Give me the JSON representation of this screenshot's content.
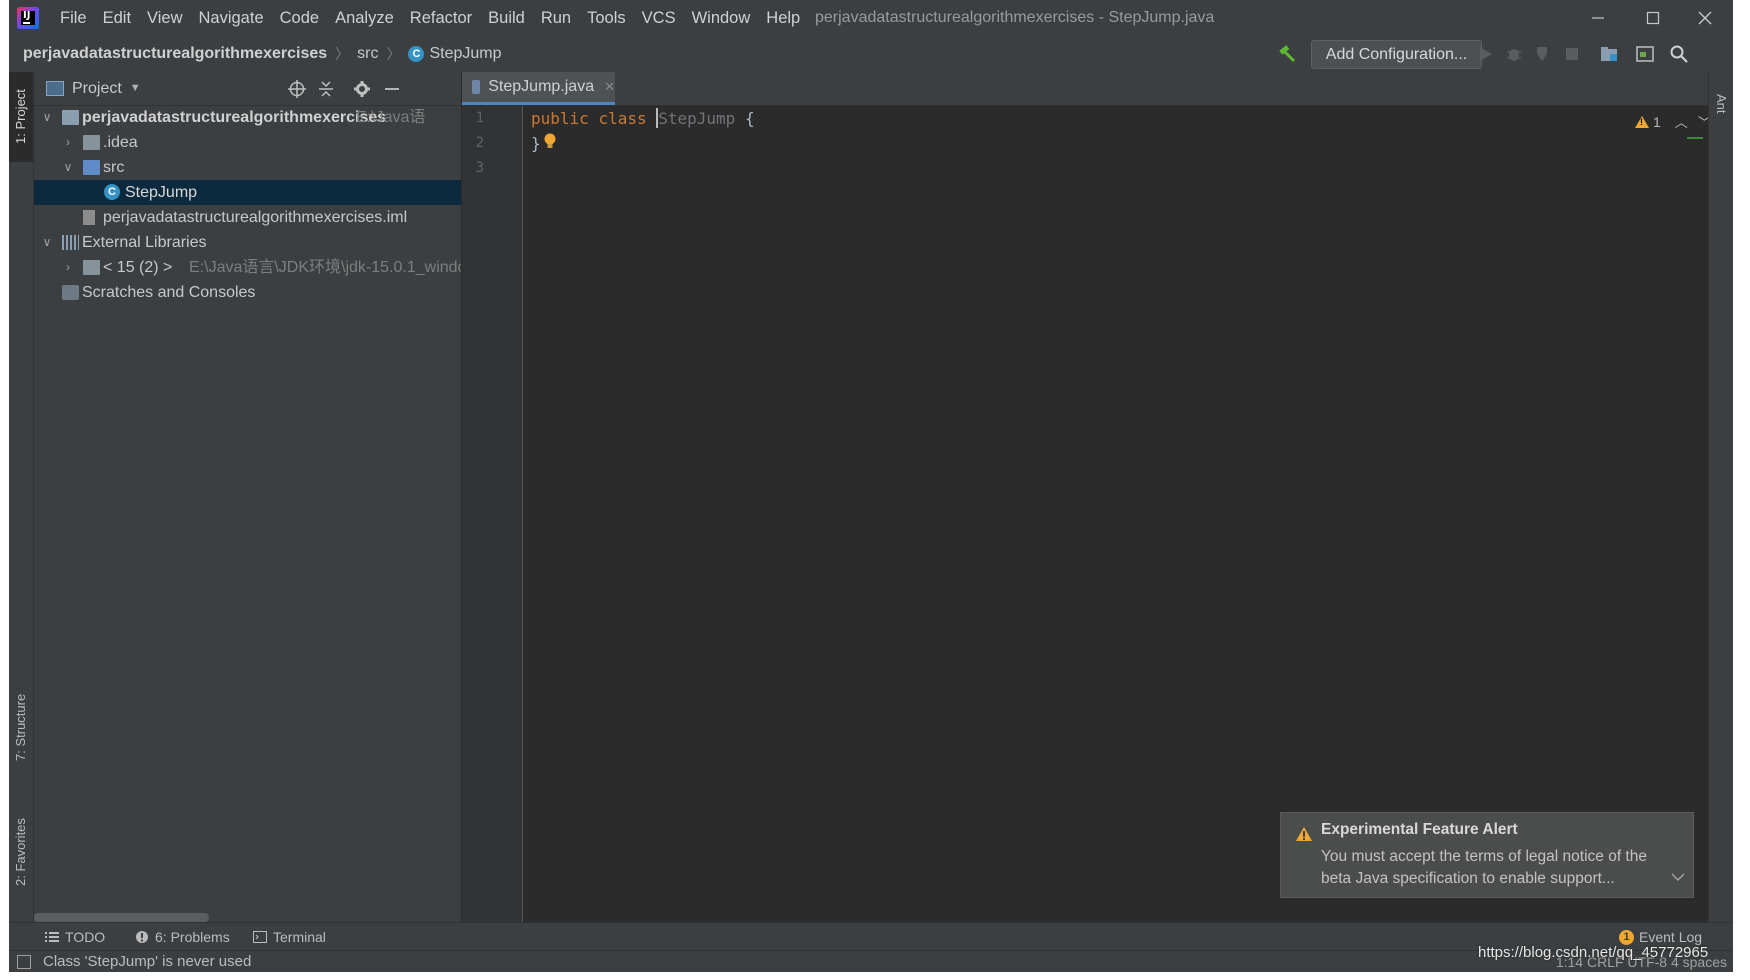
{
  "menu": {
    "items": [
      "File",
      "Edit",
      "View",
      "Navigate",
      "Code",
      "Analyze",
      "Refactor",
      "Build",
      "Run",
      "Tools",
      "VCS",
      "Window",
      "Help"
    ]
  },
  "window": {
    "title": "perjavadatastructurealgorithmexercises - StepJump.java"
  },
  "breadcrumb": {
    "project": "perjavadatastructurealgorithmexercises",
    "folder": "src",
    "file": "StepJump"
  },
  "toolbar": {
    "add_config_label": "Add Configuration..."
  },
  "left_stripe": {
    "project_tab": "1: Project",
    "structure_tab": "7: Structure",
    "favorites_tab": "2: Favorites"
  },
  "right_stripe": {
    "ant_tab": "Ant"
  },
  "project_panel": {
    "title": "Project",
    "tree": [
      {
        "label": "perjavadatastructurealgorithmexercises",
        "hint": "E:\\Java语",
        "expanded": true
      },
      {
        "label": ".idea"
      },
      {
        "label": "src"
      },
      {
        "label": "StepJump"
      },
      {
        "label": "perjavadatastructurealgorithmexercises.iml"
      },
      {
        "label": "External Libraries"
      },
      {
        "label": "< 15 (2) >",
        "hint": "E:\\Java语言\\JDK环境\\jdk-15.0.1_windo"
      },
      {
        "label": "Scratches and Consoles"
      }
    ]
  },
  "editor": {
    "tab_label": "StepJump.java",
    "line_numbers": [
      "1",
      "2",
      "3"
    ],
    "code": {
      "kw_public": "public",
      "kw_class": "class",
      "class_name": "StepJump",
      "open_brace": " {",
      "close_brace": "}"
    },
    "warning_count": "1"
  },
  "notification": {
    "title": "Experimental Feature Alert",
    "body": "You must accept the terms of legal notice of the beta Java specification to enable support..."
  },
  "tool_windows": {
    "todo": "TODO",
    "problems": "6: Problems",
    "terminal": "Terminal",
    "event_log": "Event Log",
    "event_count": "1"
  },
  "status": {
    "message": "Class 'StepJump' is never used",
    "right": "1:14  CRLF  UTF-8  4 spaces"
  },
  "watermark": "https://blog.csdn.net/qq_45772965"
}
